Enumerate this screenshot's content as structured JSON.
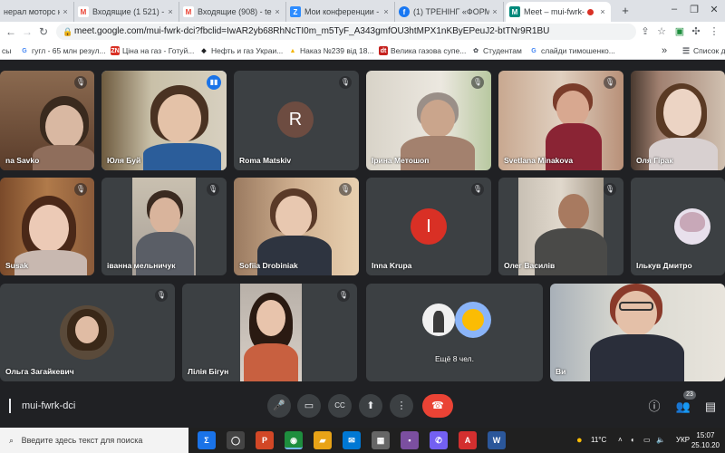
{
  "browser": {
    "tabs": [
      {
        "title": "нерал моторс юг",
        "favicon": "G",
        "color": "#5f6368"
      },
      {
        "title": "Входящие (1 521) - р",
        "favicon": "M",
        "color": "#ea4335"
      },
      {
        "title": "Входящие (908) - teb",
        "favicon": "M",
        "color": "#ea4335"
      },
      {
        "title": "Мои конференции -",
        "favicon": "Z",
        "color": "#2d8cff"
      },
      {
        "title": "(1) ТРЕНІНГ «ФОРМУ",
        "favicon": "f",
        "color": "#1877f2"
      },
      {
        "title": "Meet – mui-fwrk-",
        "favicon": "M",
        "color": "#00897b"
      }
    ],
    "new_tab": "+",
    "url": "meet.google.com/mui-fwrk-dci?fbclid=IwAR2yb68RhNcTI0m_m5TyF_A343gmfOU3htMPX1nKByEPeuJ2-btTNr9R1BU",
    "bookmarks": [
      {
        "label": "гугл - 65 млн резул...",
        "icon": "G",
        "color": "#4285f4"
      },
      {
        "label": "Ціна на газ - Готуй...",
        "icon": "ZN",
        "color": "#d93025"
      },
      {
        "label": "Нефть и газ Украи...",
        "icon": "◆",
        "color": "#202124"
      },
      {
        "label": "Наказ №239 від 18...",
        "icon": "▲",
        "color": "#f4b400"
      },
      {
        "label": "Велика газова супе...",
        "icon": "dt",
        "color": "#c5221f"
      },
      {
        "label": "Студентам",
        "icon": "✿",
        "color": "#5f6368"
      },
      {
        "label": "слайди тимошенко...",
        "icon": "G",
        "color": "#4285f4"
      }
    ],
    "bookmarks_left": "сы",
    "bookmarks_more": "»",
    "reading_list": "Список д"
  },
  "meet": {
    "participants": [
      {
        "name": "na Savko",
        "muted": true
      },
      {
        "name": "Юля Буй",
        "muted": false,
        "speaking": true
      },
      {
        "name": "Roma Matskiv",
        "muted": true,
        "letter": "R",
        "avatar_color": "#6d4c41"
      },
      {
        "name": "Ірина Метошоп",
        "muted": true
      },
      {
        "name": "Svetlana Minakova",
        "muted": true
      },
      {
        "name": "Оля Гірак",
        "muted": true
      },
      {
        "name": "Susak",
        "muted": true
      },
      {
        "name": "іванна мельничук",
        "muted": true
      },
      {
        "name": "Sofiia Drobiniak",
        "muted": true
      },
      {
        "name": "Inna Krupa",
        "muted": true,
        "letter": "I",
        "avatar_color": "#d93025"
      },
      {
        "name": "Олег Василів",
        "muted": true
      },
      {
        "name": "Ількув Дмитро",
        "muted": true
      },
      {
        "name": "Ольга Загайкевич",
        "muted": true
      },
      {
        "name": "Лілія Бігун",
        "muted": true
      },
      {
        "name": "Ще 8 чел.",
        "muted": false
      },
      {
        "name": "Ви",
        "muted": false
      }
    ],
    "more_label": "Ещё 8 чел.",
    "meeting_code": "mui-fwrk-dci",
    "people_count": "23"
  },
  "taskbar": {
    "search_placeholder": "Введите здесь текст для поиска",
    "weather": "11°C",
    "lang": "УКР",
    "time": "15:07",
    "date": "25.10.20"
  }
}
